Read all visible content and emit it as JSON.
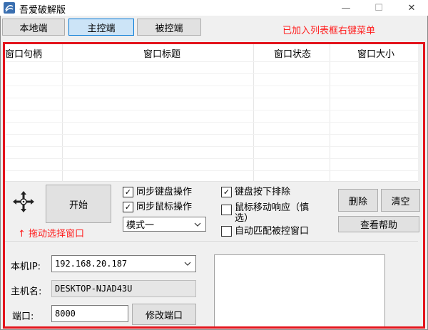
{
  "window": {
    "title": "吾爱破解版",
    "minimize_symbol": "—",
    "maximize_symbol": "☐",
    "close_symbol": "✕"
  },
  "tabs": [
    {
      "label": "本地端",
      "active": false
    },
    {
      "label": "主控端",
      "active": true
    },
    {
      "label": "被控端",
      "active": false
    }
  ],
  "notice": "已加入列表框右键菜单",
  "list": {
    "columns": [
      "窗口句柄",
      "窗口标题",
      "窗口状态",
      "窗口大小"
    ]
  },
  "controls": {
    "drag_icon": "crosshair-move-icon",
    "start_button": "开始",
    "drag_tip": "↑ 拖动选择窗口",
    "sync_keyboard": {
      "label": "同步键盘操作",
      "checked": true
    },
    "sync_mouse": {
      "label": "同步鼠标操作",
      "checked": true
    },
    "mode_select": "模式一",
    "keyboard_exclude": {
      "label": "键盘按下排除",
      "checked": true
    },
    "mouse_move_response": {
      "label_line1": "鼠标移动响应（慎",
      "label_line2": "选）",
      "checked": false
    },
    "auto_match": {
      "label": "自动匹配被控窗口",
      "checked": false
    },
    "delete_button": "删除",
    "clear_button": "清空",
    "help_button": "查看帮助"
  },
  "host": {
    "ip_label": "本机IP:",
    "ip_value": "192.168.20.187",
    "hostname_label": "主机名:",
    "hostname_value": "DESKTOP-NJAD43U",
    "port_label": "端口:",
    "port_value": "8000",
    "modify_port_button": "修改端口"
  },
  "colors": {
    "highlight_red": "#e3141c",
    "notice_red": "#ff2020",
    "active_tab": "#cce4f7"
  }
}
